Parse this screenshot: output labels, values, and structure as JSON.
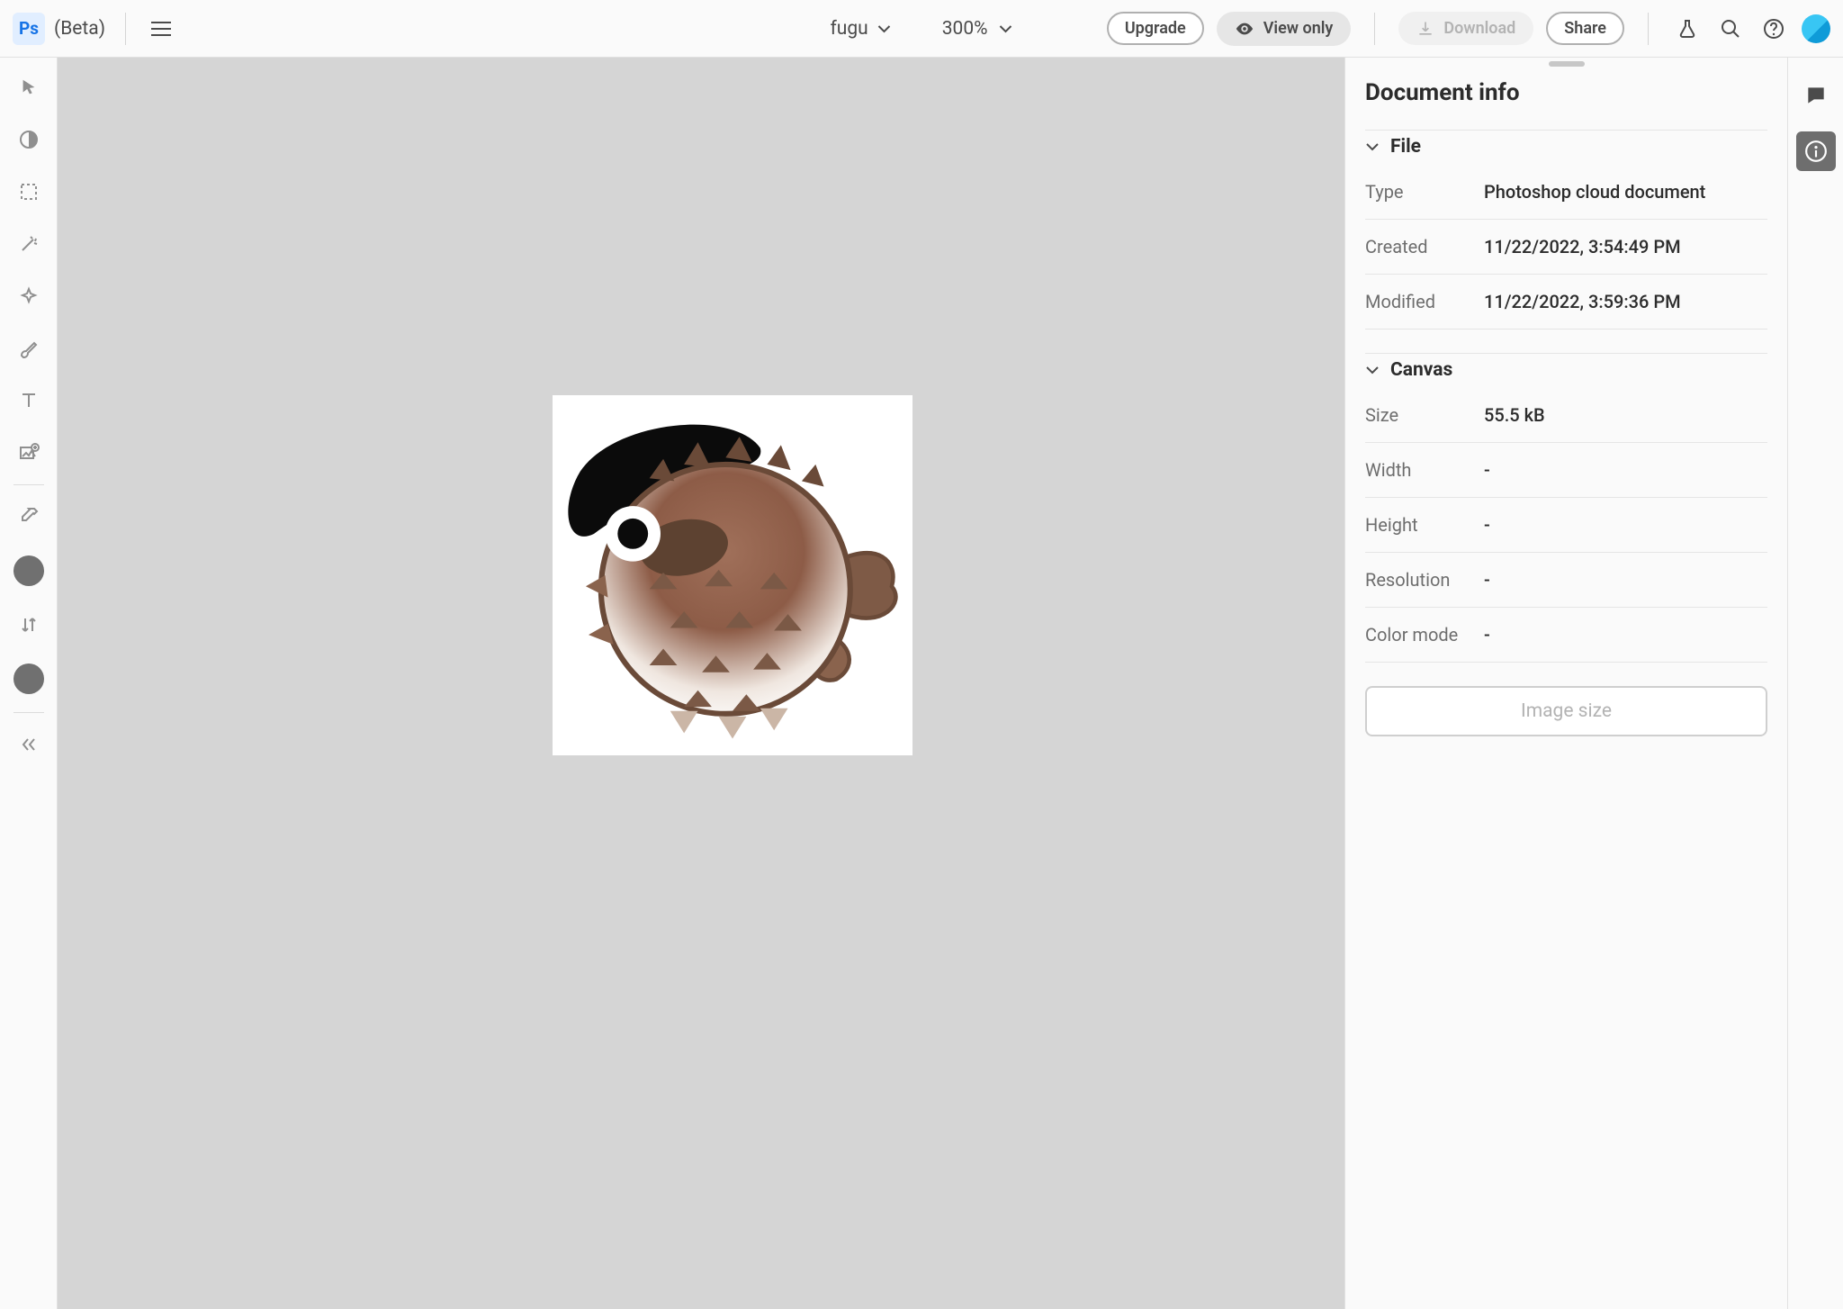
{
  "header": {
    "logo_text": "Ps",
    "beta_label": "(Beta)",
    "doc_name": "fugu",
    "zoom": "300%",
    "upgrade": "Upgrade",
    "view_only": "View only",
    "download": "Download",
    "share": "Share"
  },
  "panel": {
    "title": "Document info",
    "file_section": "File",
    "canvas_section": "Canvas",
    "rows": {
      "type_label": "Type",
      "type_value": "Photoshop cloud document",
      "created_label": "Created",
      "created_value": "11/22/2022, 3:54:49 PM",
      "modified_label": "Modified",
      "modified_value": "11/22/2022, 3:59:36 PM",
      "size_label": "Size",
      "size_value": "55.5 kB",
      "width_label": "Width",
      "width_value": "-",
      "height_label": "Height",
      "height_value": "-",
      "resolution_label": "Resolution",
      "resolution_value": "-",
      "colormode_label": "Color mode",
      "colormode_value": "-"
    },
    "image_size_btn": "Image size"
  }
}
